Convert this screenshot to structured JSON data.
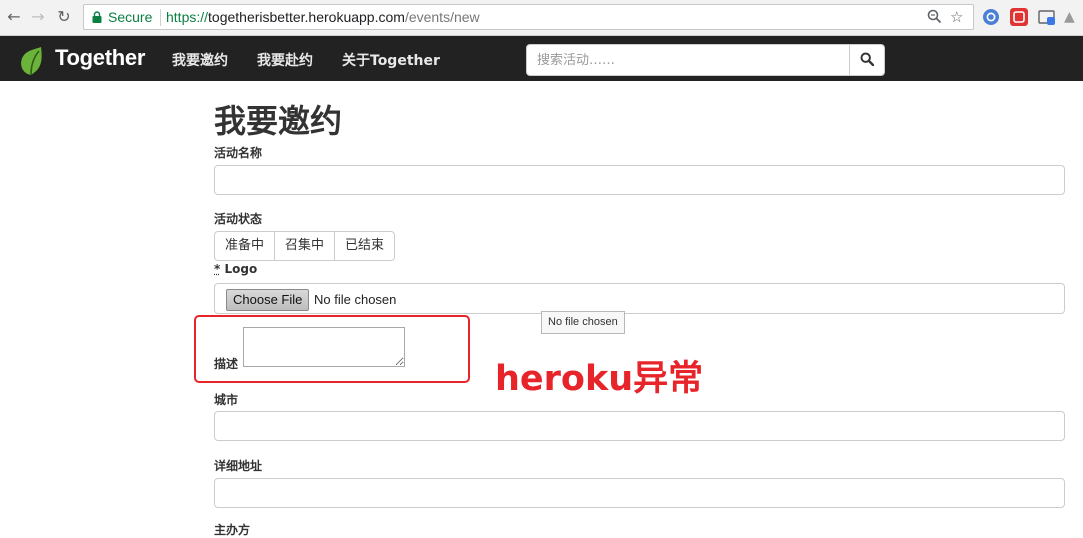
{
  "browser": {
    "back_icon": "back-arrow-icon",
    "forward_icon": "forward-arrow-icon",
    "reload_icon": "reload-icon",
    "secure_label": "Secure",
    "url_scheme": "https://",
    "url_host": "togetherisbetter.herokuapp.com",
    "url_path": "/events/new",
    "zoom_icon": "zoom-icon",
    "bookmark_icon": "star-icon",
    "extensions": [
      "chrome-ext-icon",
      "red-ext-icon",
      "cast-ext-icon",
      "share-ext-icon"
    ]
  },
  "navbar": {
    "brand": "Together",
    "links": [
      "我要邀约",
      "我要赴约",
      "关于Together"
    ],
    "search_placeholder": "搜索活动……",
    "search_icon": "search-icon",
    "colors": {
      "background": "#222222",
      "brand_leaf": "#6bb33a"
    }
  },
  "form": {
    "title": "我要邀约",
    "name_label": "活动名称",
    "status_label": "活动状态",
    "status_options": [
      "准备中",
      "召集中",
      "已结束"
    ],
    "logo_required_mark": "*",
    "logo_label": "Logo",
    "choose_file_label": "Choose File",
    "no_file_text": "No file chosen",
    "tooltip": "No file chosen",
    "description_label": "描述",
    "city_label": "城市",
    "address_label": "详细地址",
    "organizer_label": "主办方"
  },
  "annotation": {
    "text": "heroku异常",
    "color": "#e8242b"
  }
}
